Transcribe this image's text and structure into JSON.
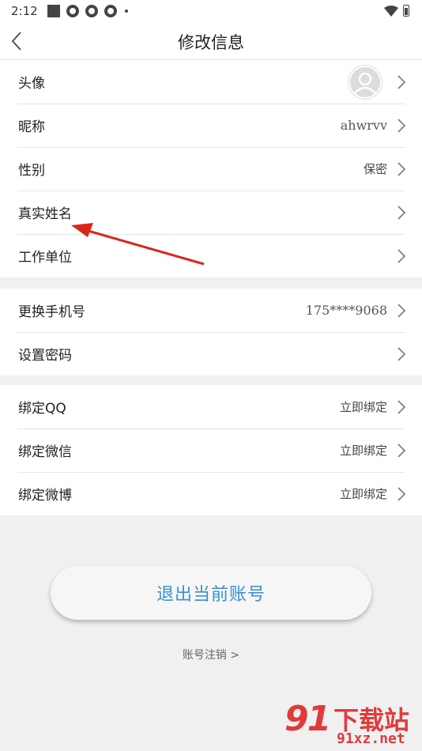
{
  "status_bar": {
    "time": "2:12"
  },
  "header": {
    "title": "修改信息"
  },
  "groups": [
    {
      "items": [
        {
          "label": "头像",
          "value": ""
        },
        {
          "label": "昵称",
          "value": "ahwrvv"
        },
        {
          "label": "性别",
          "value": "保密"
        },
        {
          "label": "真实姓名",
          "value": ""
        },
        {
          "label": "工作单位",
          "value": ""
        }
      ]
    },
    {
      "items": [
        {
          "label": "更换手机号",
          "value": "175****9068"
        },
        {
          "label": "设置密码",
          "value": ""
        }
      ]
    },
    {
      "items": [
        {
          "label": "绑定QQ",
          "value": "立即绑定"
        },
        {
          "label": "绑定微信",
          "value": "立即绑定"
        },
        {
          "label": "绑定微博",
          "value": "立即绑定"
        }
      ]
    }
  ],
  "logout_label": "退出当前账号",
  "cancel_account_label": "账号注销 >",
  "watermark": {
    "brand_digits": "91",
    "brand_cn": "下载站",
    "url": "91xz.net"
  },
  "colors": {
    "accent": "#3a8fd0",
    "annotation": "#d9261c",
    "watermark": "#e23a3a"
  },
  "icons": {
    "back": "chevron-left-icon",
    "row_arrow": "chevron-right-icon",
    "avatar": "default-user-avatar"
  }
}
